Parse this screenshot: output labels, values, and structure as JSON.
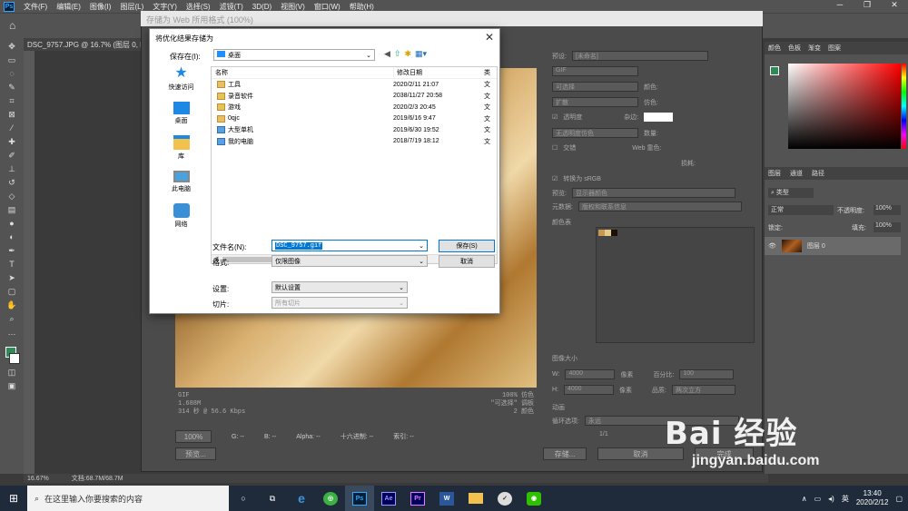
{
  "menubar": {
    "app_icon": "Ps",
    "items": [
      "文件(F)",
      "编辑(E)",
      "图像(I)",
      "图层(L)",
      "文字(Y)",
      "选择(S)",
      "滤镜(T)",
      "3D(D)",
      "视图(V)",
      "窗口(W)",
      "帮助(H)"
    ]
  },
  "doc_tab": "DSC_9757.JPG @ 16.7% (图层 0, RGB",
  "sfw": {
    "title": "存储为 Web 所用格式 (100%)",
    "preview_info": [
      "GIF",
      "1.688M",
      "314 秒 @ 56.6 Kbps"
    ],
    "preview_info_right": [
      "100% 仿色",
      "\"可选择\" 调板",
      "2 颜色"
    ],
    "status": {
      "zoom": "100%",
      "g": "G: --",
      "b": "B: --",
      "alpha": "Alpha: --",
      "hex": "十六进制: --",
      "index": "索引: --"
    },
    "buttons": {
      "preview": "预览...",
      "save": "存储...",
      "cancel": "取消",
      "done": "完成"
    },
    "right": {
      "preset_label": "预设:",
      "preset_value": "[未命名]",
      "format": "GIF",
      "reduction": "可选择",
      "dither": "扩散",
      "transparency": "透明度",
      "matte_dither": "无透明度仿色",
      "interlace": "交错",
      "colors_label": "颜色:",
      "dither_amt_label": "仿色:",
      "matte_label": "杂边:",
      "amount_label": "数量:",
      "web_snap_label": "Web 靠色:",
      "lossy_label": "损耗:",
      "convert_srgb": "转换为 sRGB",
      "preview_label": "预览:",
      "preview_value": "显示器颜色",
      "metadata_label": "元数据:",
      "metadata_value": "版权和联系信息",
      "color_table": "颜色表",
      "image_size": "图像大小",
      "w": "W:",
      "h": "H:",
      "w_val": "4000",
      "h_val": "4000",
      "px": "像素",
      "percent_label": "百分比:",
      "percent_val": "100",
      "quality_label": "品质:",
      "quality_val": "两次立方",
      "animation": "动画",
      "loop_label": "循环选项:",
      "loop_value": "永远",
      "frame": "1/1"
    }
  },
  "panels": {
    "color_tabs": [
      "颜色",
      "色板",
      "渐变",
      "图案"
    ],
    "layer_tabs": [
      "图层",
      "通道",
      "路径"
    ],
    "kind": "类型",
    "blend": "正常",
    "opacity_label": "不透明度:",
    "opacity": "100%",
    "lock_label": "锁定:",
    "fill_label": "填充:",
    "fill": "100%",
    "layer_name": "图层 0"
  },
  "ps_status": {
    "zoom": "16.67%",
    "doc": "文档:68.7M/68.7M"
  },
  "dialog": {
    "title": "将优化结果存储为",
    "save_in_label": "保存在(I):",
    "save_in_value": "桌面",
    "nav": [
      {
        "label": "快速访问",
        "icon": "star-icon"
      },
      {
        "label": "桌面",
        "icon": "desktop-icon"
      },
      {
        "label": "库",
        "icon": "library-icon"
      },
      {
        "label": "此电脑",
        "icon": "pc-icon"
      },
      {
        "label": "网络",
        "icon": "network-icon"
      }
    ],
    "columns": {
      "name": "名称",
      "date": "修改日期",
      "type": "类"
    },
    "files": [
      {
        "name": "工具",
        "date": "2020/2/11 21:07",
        "type": "文"
      },
      {
        "name": "录音软件",
        "date": "2038/11/27 20:58",
        "type": "文"
      },
      {
        "name": "游戏",
        "date": "2020/2/3 20:45",
        "type": "文"
      },
      {
        "name": "0qjc",
        "date": "2019/6/16 9:47",
        "type": "文"
      },
      {
        "name": "大型单机",
        "date": "2019/6/30 19:52",
        "type": "文"
      },
      {
        "name": "我的电脑",
        "date": "2018/7/19 18:12",
        "type": "文"
      }
    ],
    "filename_label": "文件名(N):",
    "filename_value": "DSC_9757.gif",
    "format_label": "格式:",
    "format_value": "仅限图像",
    "settings_label": "设置:",
    "settings_value": "默认设置",
    "slices_label": "切片:",
    "slices_value": "所有切片",
    "save_button": "保存(S)",
    "cancel_button": "取消"
  },
  "taskbar": {
    "search_placeholder": "在这里输入你要搜索的内容",
    "apps": [
      "Ps",
      "Ae",
      "Pr"
    ],
    "ime": "英",
    "time": "13:40",
    "date": "2020/2/12"
  },
  "watermark": {
    "logo": "Bai 经验",
    "url": "jingyan.baidu.com"
  }
}
